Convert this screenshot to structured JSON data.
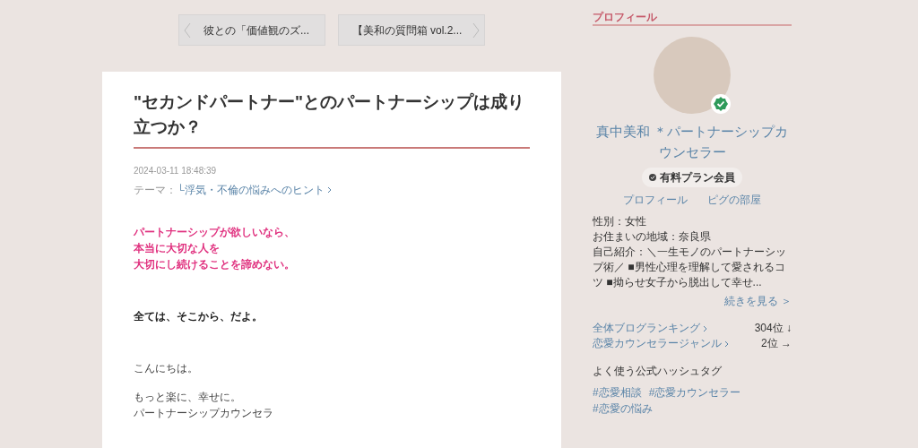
{
  "post_nav": [
    {
      "label": "彼との「価値観のズ...",
      "kind": "prev"
    },
    {
      "label": "【美和の質問箱 vol.2...",
      "kind": "next"
    }
  ],
  "article": {
    "title": "\"セカンドパートナー\"とのパートナーシップは成り立つか？",
    "date": "2024-03-11 18:48:39",
    "theme_label": "テーマ：",
    "theme": "└浮気・不倫の悩みへのヒント",
    "paragraphs": [
      {
        "kind": "accent",
        "lines": [
          "パートナーシップが欲しいなら、",
          "本当に大切な人を",
          "大切にし続けることを諦めない。"
        ]
      },
      {
        "kind": "bold",
        "lines": [
          "全ては、そこから、だよ。"
        ]
      },
      {
        "kind": "plain",
        "lines": [
          "こんにちは。"
        ]
      },
      {
        "kind": "plain",
        "lines": [
          "もっと楽に、幸せに。",
          "パートナーシップカウンセラ"
        ]
      }
    ]
  },
  "profile": {
    "heading": "プロフィール",
    "verified": true,
    "name": "真中美和 ＊パートナーシップカウンセラー",
    "badge": "有料プラン会員",
    "links": [
      "プロフィール",
      "ピグの部屋"
    ],
    "details": [
      "性別：女性",
      "お住まいの地域：奈良県",
      "自己紹介：＼一生モノのパートナーシップ術／ ■男性心理を理解して愛されるコツ ■拗らせ女子から脱出して幸せ..."
    ],
    "more": "続きを見る ＞",
    "rankings": [
      {
        "label": "全体ブログランキング",
        "rank": "304位",
        "trend": "↓"
      },
      {
        "label": "恋愛カウンセラージャンル",
        "rank": "2位",
        "trend": "→"
      }
    ],
    "hashtags_heading": "よく使う公式ハッシュタグ",
    "hashtags": [
      "#恋愛相談",
      "#恋愛カウンセラー",
      "#恋愛の悩み"
    ]
  }
}
